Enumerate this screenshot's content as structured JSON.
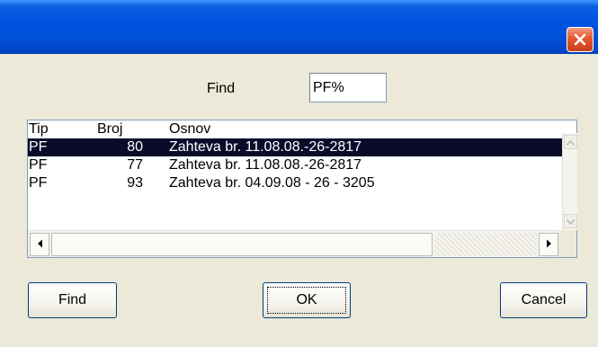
{
  "window": {
    "title": ""
  },
  "search": {
    "label": "Find",
    "value": "PF%"
  },
  "list": {
    "columns": [
      "Tip",
      "Broj",
      "Osnov"
    ],
    "rows": [
      {
        "tip": "PF",
        "broj": "80",
        "osnov": "Zahteva br. 11.08.08.-26-2817",
        "selected": true
      },
      {
        "tip": "PF",
        "broj": "77",
        "osnov": "Zahteva br. 11.08.08.-26-2817",
        "selected": false
      },
      {
        "tip": "PF",
        "broj": "93",
        "osnov": "Zahteva br. 04.09.08 - 26 - 3205",
        "selected": false
      }
    ]
  },
  "buttons": {
    "find": "Find",
    "ok": "OK",
    "cancel": "Cancel"
  },
  "colors": {
    "titlebar": "#0054e3",
    "close": "#e6582f",
    "selection": "#0a0a2a",
    "dialog": "#ece9d8"
  },
  "icons": {
    "close": "close-icon",
    "scroll_up": "chevron-up-icon",
    "scroll_down": "chevron-down-icon",
    "scroll_left": "chevron-left-icon",
    "scroll_right": "chevron-right-icon"
  }
}
